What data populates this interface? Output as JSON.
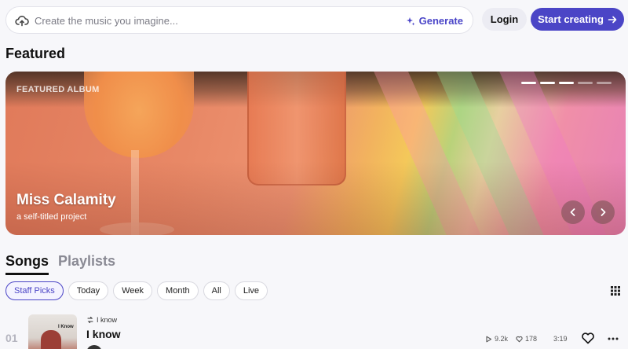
{
  "header": {
    "prompt_placeholder": "Create the music you imagine...",
    "generate_label": "Generate",
    "login_label": "Login",
    "start_label": "Start creating"
  },
  "featured": {
    "section_title": "Featured",
    "label": "FEATURED ALBUM",
    "album_title": "Miss Calamity",
    "album_subtitle": "a self-titled project",
    "slide_count": 5,
    "active_slides": 3
  },
  "tabs": [
    {
      "label": "Songs",
      "active": true
    },
    {
      "label": "Playlists",
      "active": false
    }
  ],
  "filters": [
    {
      "label": "Staff Picks",
      "active": true
    },
    {
      "label": "Today",
      "active": false
    },
    {
      "label": "Week",
      "active": false
    },
    {
      "label": "Month",
      "active": false
    },
    {
      "label": "All",
      "active": false
    },
    {
      "label": "Live",
      "active": false
    }
  ],
  "songs": [
    {
      "index": "01",
      "cover_text": "I Know",
      "meta": "I know",
      "title": "I know",
      "plays": "9.2k",
      "likes": "178",
      "duration": "3:19"
    }
  ],
  "colors": {
    "accent": "#4b45c6",
    "generate": "#4a45c8",
    "background": "#f7f7fa"
  },
  "icons": {
    "prompt": "cloud-upload-icon",
    "generate": "sparkle-icon",
    "start": "arrow-right-icon",
    "prev": "chevron-left-icon",
    "next": "chevron-right-icon",
    "grid": "grid-icon",
    "like": "heart-icon",
    "more": "more-horizontal-icon"
  }
}
